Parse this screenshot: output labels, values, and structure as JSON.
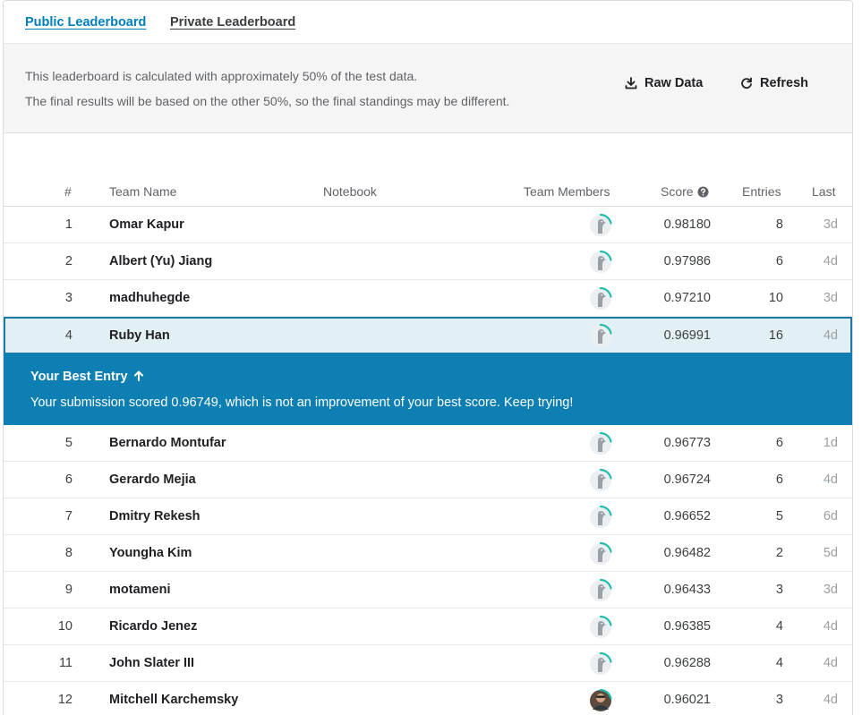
{
  "tabs": [
    {
      "label": "Public Leaderboard",
      "active": true
    },
    {
      "label": "Private Leaderboard",
      "active": false
    }
  ],
  "info": {
    "line1": "This leaderboard is calculated with approximately 50% of the test data.",
    "line2": "The final results will be based on the other 50%, so the final standings may be different.",
    "raw_data_label": "Raw Data",
    "refresh_label": "Refresh"
  },
  "columns": {
    "rank": "#",
    "team_name": "Team Name",
    "notebook": "Notebook",
    "team_members": "Team Members",
    "score": "Score",
    "entries": "Entries",
    "last": "Last"
  },
  "banner": {
    "title": "Your Best Entry",
    "text": "Your submission scored 0.96749, which is not an improvement of your best score. Keep trying!"
  },
  "colors": {
    "accent": "#007dbb",
    "banner_bg": "#0e7fb2",
    "highlight_bg": "#e2f0f6",
    "progress_ring": "#20beac"
  },
  "rows": [
    {
      "rank": "1",
      "team": "Omar Kapur",
      "score": "0.98180",
      "entries": "8",
      "last": "3d",
      "avatar": "default"
    },
    {
      "rank": "2",
      "team": "Albert (Yu) Jiang",
      "score": "0.97986",
      "entries": "6",
      "last": "4d",
      "avatar": "default"
    },
    {
      "rank": "3",
      "team": "madhuhegde",
      "score": "0.97210",
      "entries": "10",
      "last": "3d",
      "avatar": "default"
    },
    {
      "rank": "4",
      "team": "Ruby Han",
      "score": "0.96991",
      "entries": "16",
      "last": "4d",
      "avatar": "default",
      "highlight": true
    },
    {
      "rank": "5",
      "team": "Bernardo Montufar",
      "score": "0.96773",
      "entries": "6",
      "last": "1d",
      "avatar": "default"
    },
    {
      "rank": "6",
      "team": "Gerardo Mejia",
      "score": "0.96724",
      "entries": "6",
      "last": "4d",
      "avatar": "default"
    },
    {
      "rank": "7",
      "team": "Dmitry Rekesh",
      "score": "0.96652",
      "entries": "5",
      "last": "6d",
      "avatar": "default"
    },
    {
      "rank": "8",
      "team": "Youngha Kim",
      "score": "0.96482",
      "entries": "2",
      "last": "5d",
      "avatar": "default"
    },
    {
      "rank": "9",
      "team": "motameni",
      "score": "0.96433",
      "entries": "3",
      "last": "3d",
      "avatar": "default"
    },
    {
      "rank": "10",
      "team": "Ricardo Jenez",
      "score": "0.96385",
      "entries": "4",
      "last": "4d",
      "avatar": "default"
    },
    {
      "rank": "11",
      "team": "John Slater III",
      "score": "0.96288",
      "entries": "4",
      "last": "4d",
      "avatar": "default"
    },
    {
      "rank": "12",
      "team": "Mitchell Karchemsky",
      "score": "0.96021",
      "entries": "3",
      "last": "4d",
      "avatar": "photo"
    }
  ]
}
